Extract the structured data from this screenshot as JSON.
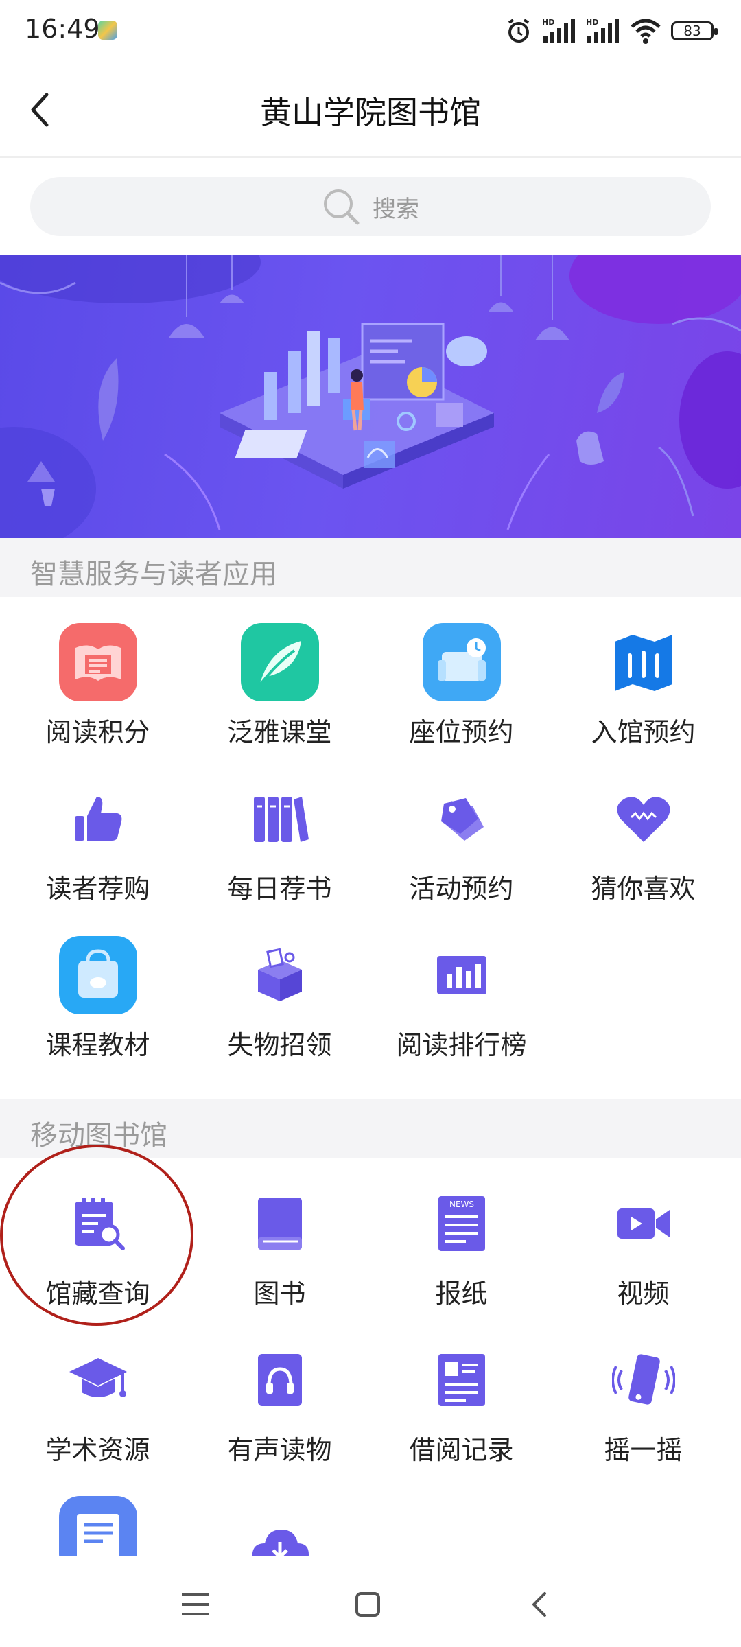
{
  "status_bar": {
    "time": "16:49",
    "battery": "83",
    "signal_label": "HD"
  },
  "header": {
    "title": "黄山学院图书馆"
  },
  "search": {
    "placeholder": "搜索"
  },
  "section1": {
    "title": "智慧服务与读者应用",
    "items": [
      {
        "label": "阅读积分",
        "icon": "reading-points-icon"
      },
      {
        "label": "泛雅课堂",
        "icon": "fanya-classroom-icon"
      },
      {
        "label": "座位预约",
        "icon": "seat-reservation-icon"
      },
      {
        "label": "入馆预约",
        "icon": "entry-reservation-icon"
      },
      {
        "label": "读者荐购",
        "icon": "thumbs-up-icon"
      },
      {
        "label": "每日荐书",
        "icon": "books-icon"
      },
      {
        "label": "活动预约",
        "icon": "tag-icon"
      },
      {
        "label": "猜你喜欢",
        "icon": "heart-icon"
      },
      {
        "label": "课程教材",
        "icon": "shopping-bag-icon"
      },
      {
        "label": "失物招领",
        "icon": "box-icon"
      },
      {
        "label": "阅读排行榜",
        "icon": "ranking-chart-icon"
      }
    ]
  },
  "section2": {
    "title": "移动图书馆",
    "items": [
      {
        "label": "馆藏查询",
        "icon": "catalog-search-icon"
      },
      {
        "label": "图书",
        "icon": "book-icon"
      },
      {
        "label": "报纸",
        "icon": "newspaper-icon",
        "badge": "NEWS"
      },
      {
        "label": "视频",
        "icon": "video-camera-icon"
      },
      {
        "label": "学术资源",
        "icon": "graduation-cap-icon"
      },
      {
        "label": "有声读物",
        "icon": "audiobook-icon"
      },
      {
        "label": "借阅记录",
        "icon": "borrow-record-icon"
      },
      {
        "label": "摇一摇",
        "icon": "shake-phone-icon"
      }
    ]
  },
  "colors": {
    "accent": "#6a5ae8",
    "annotation": "#b0201a",
    "section_bg": "#f4f4f6"
  }
}
